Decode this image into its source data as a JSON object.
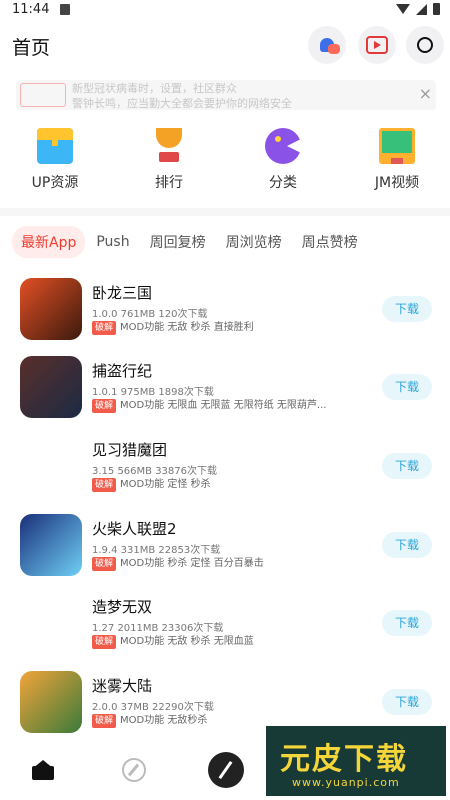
{
  "status_bar": {
    "time": "11:44"
  },
  "header": {
    "title": "首页"
  },
  "banner": {
    "tag": "",
    "line1": "新型冠状病毒时，设置，社区群众",
    "line2": "警钟长鸣，应当勤大全都会要护你的网络安全"
  },
  "categories": [
    {
      "label": "UP资源",
      "icon": "toolbox-icon"
    },
    {
      "label": "排行",
      "icon": "trophy-icon"
    },
    {
      "label": "分类",
      "icon": "pacman-icon"
    },
    {
      "label": "JM视频",
      "icon": "screen-icon"
    }
  ],
  "tabs": [
    "最新App",
    "Push",
    "周回复榜",
    "周浏览榜",
    "周点赞榜"
  ],
  "apps": [
    {
      "name": "卧龙三国",
      "meta": "1.0.0 761MB 120次下载",
      "crack": "破解",
      "features": "MOD功能 无敌 秒杀 直接胜利",
      "button": "下载"
    },
    {
      "name": "捕盗行纪",
      "meta": "1.0.1 975MB 1898次下载",
      "crack": "破解",
      "features": "MOD功能 无限血 无限蓝 无限符纸 无限葫芦...",
      "button": "下载"
    },
    {
      "name": "见习猎魔团",
      "meta": "3.15 566MB 33876次下载",
      "crack": "破解",
      "features": "MOD功能 定怪 秒杀",
      "button": "下载"
    },
    {
      "name": "火柴人联盟2",
      "meta": "1.9.4 331MB 22853次下载",
      "crack": "破解",
      "features": "MOD功能 秒杀 定怪 百分百暴击",
      "button": "下载"
    },
    {
      "name": "造梦无双",
      "meta": "1.27 2011MB 23306次下载",
      "crack": "破解",
      "features": "MOD功能 无敌 秒杀 无限血蓝",
      "button": "下载"
    },
    {
      "name": "迷雾大陆",
      "meta": "2.0.0 37MB 22290次下载",
      "crack": "破解",
      "features": "MOD功能 无敌秒杀",
      "button": "下载"
    }
  ],
  "watermark": {
    "title": "元皮下载",
    "url": "www.yuanpi.com"
  }
}
